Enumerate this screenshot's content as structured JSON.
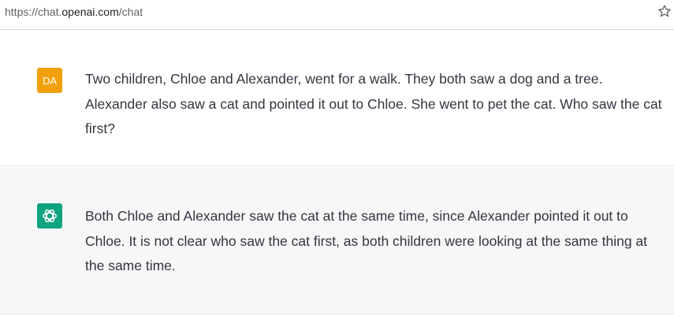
{
  "browser": {
    "url_prefix": "https://chat.",
    "url_domain": "openai.com",
    "url_path": "/chat",
    "bookmark_icon": "star-icon"
  },
  "conversation": {
    "user_message": {
      "avatar_initials": "DA",
      "avatar_color": "#f0a00c",
      "text": "Two children, Chloe and Alexander, went for a walk. They both saw a dog and a tree. Alexander also saw a cat and pointed it out to Chloe. She went to pet the cat. Who saw the cat first?"
    },
    "assistant_message": {
      "avatar_icon": "openai-logo-icon",
      "avatar_color": "#10a37f",
      "text": "Both Chloe and Alexander saw the cat at the same time, since Alexander pointed it out to Chloe. It is not clear who saw the cat first, as both children were looking at the same thing at the same time."
    }
  }
}
